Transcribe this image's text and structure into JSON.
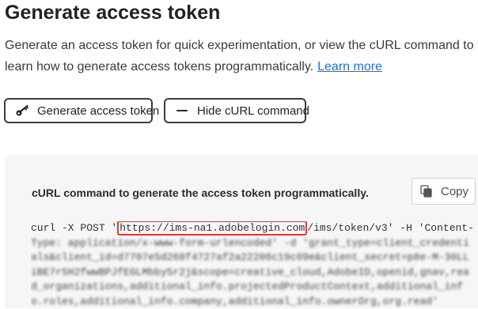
{
  "page": {
    "title": "Generate access token",
    "description": "Generate an access token for quick experimentation, or view the cURL command to learn how to generate access tokens programmatically.",
    "learn_more": "Learn more"
  },
  "buttons": {
    "generate_label": "Generate access token",
    "generate_icon": "key-icon",
    "hide_curl_label": "Hide cURL command",
    "hide_curl_icon": "minus-icon"
  },
  "curl_panel": {
    "title": "cURL command to generate the access token programmatically.",
    "copy_label": "Copy",
    "copy_icon": "copy-icon",
    "code": {
      "prefix": "curl -X POST '",
      "highlighted_url": "https://ims-na1.adobelogin.com",
      "suffix": "/ims/token/v3' -H 'Content-",
      "blurred_lines": [
        "Type: application/x-www-form-urlencoded' -d 'grant_type=client_credenti",
        "als&client_id=d7707e5d268f4727af2a22206c19c09e&client_secret=p8e-M-30LL",
        "iBE7r5H2fwwBPJfEGLMbby5r2j&scope=creative_cloud,AdobeID,openid,gnav,rea",
        "d_organizations,additional_info.projectedProductContext,additional_inf",
        "o.roles,additional_info.company,additional_info.ownerOrg,org.read'"
      ]
    }
  },
  "colors": {
    "link": "#1f6fd1",
    "highlight_border": "#d93a3a",
    "panel_background": "#f6f6f6"
  }
}
